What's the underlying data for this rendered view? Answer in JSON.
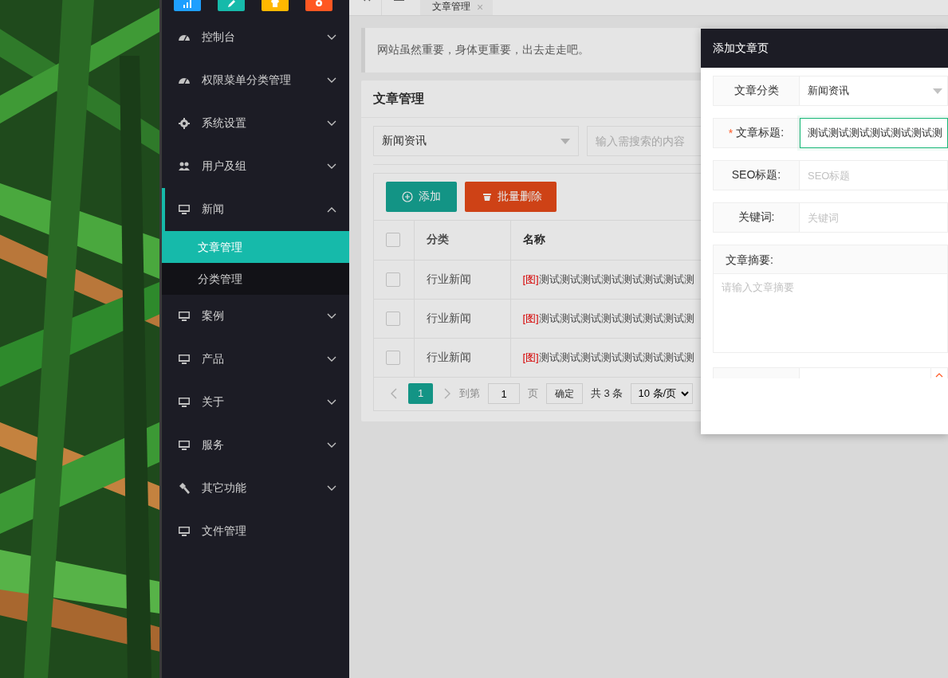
{
  "top_icons": [
    {
      "kind": "chart",
      "color": "#1e9fff"
    },
    {
      "kind": "edit",
      "color": "#16baaa"
    },
    {
      "kind": "shirt",
      "color": "#ffb800"
    },
    {
      "kind": "gear",
      "color": "#ff5722"
    }
  ],
  "sidebar": {
    "items": [
      {
        "label": "控制台",
        "kind": "gauge",
        "expanded": false,
        "selected": false
      },
      {
        "label": "权限菜单分类管理",
        "kind": "gauge",
        "expanded": false,
        "selected": false
      },
      {
        "label": "系统设置",
        "kind": "gear",
        "expanded": false,
        "selected": false
      },
      {
        "label": "用户及组",
        "kind": "users",
        "expanded": false,
        "selected": false
      },
      {
        "label": "新闻",
        "kind": "monitor",
        "expanded": true,
        "selected": true,
        "children": [
          {
            "label": "文章管理",
            "selected": true
          },
          {
            "label": "分类管理",
            "selected": false
          }
        ]
      },
      {
        "label": "案例",
        "kind": "monitor",
        "expanded": false,
        "selected": false
      },
      {
        "label": "产品",
        "kind": "monitor",
        "expanded": false,
        "selected": false
      },
      {
        "label": "关于",
        "kind": "monitor",
        "expanded": false,
        "selected": false
      },
      {
        "label": "服务",
        "kind": "monitor",
        "expanded": false,
        "selected": false
      },
      {
        "label": "其它功能",
        "kind": "hammer",
        "expanded": false,
        "selected": false
      },
      {
        "label": "文件管理",
        "kind": "monitor",
        "selected": false
      }
    ]
  },
  "tabs": [
    {
      "kind": "home",
      "selected": false
    },
    {
      "kind": "page",
      "label": "文章管理",
      "close": "×",
      "selected": true
    }
  ],
  "notice": "网站虽然重要，身体更重要，出去走走吧。",
  "card": {
    "title": "文章管理",
    "filter": {
      "category": "新闻资讯",
      "search_placeholder": "输入需搜索的内容"
    },
    "buttons": [
      {
        "kind": "add",
        "label": "添加"
      },
      {
        "kind": "delete",
        "label": "批量删除"
      }
    ],
    "table": {
      "all_checked": false,
      "columns": [
        "分类",
        "名称"
      ],
      "rows": [
        {
          "checked": false,
          "category": "行业新闻",
          "tag": "[图]",
          "name": "测试测试测试测试测试测试测试测"
        },
        {
          "checked": false,
          "category": "行业新闻",
          "tag": "[图]",
          "name": "测试测试测试测试测试测试测试测"
        },
        {
          "checked": false,
          "category": "行业新闻",
          "tag": "[图]",
          "name": "测试测试测试测试测试测试测试测"
        }
      ]
    },
    "pager": {
      "pages": [
        {
          "label": "1",
          "selected": true
        }
      ],
      "goto_label": "到第",
      "goto_value": "1",
      "page_unit": "页",
      "confirm": "确定",
      "total": "共 3 条",
      "page_size": "10 条/页"
    }
  },
  "modal": {
    "title": "添加文章页",
    "fields": [
      {
        "kind": "select",
        "label": "文章分类",
        "value": "新闻资讯",
        "focused": false
      },
      {
        "kind": "text",
        "label": "文章标题:",
        "required_mark": "*",
        "value": "测试测试测试测试测试测试测",
        "focused": true
      },
      {
        "kind": "text",
        "label": "SEO标题:",
        "placeholder": "SEO标题",
        "focused": false
      },
      {
        "kind": "text",
        "label": "关键词:",
        "placeholder": "关键词",
        "focused": false
      },
      {
        "kind": "textarea",
        "label": "文章摘要:",
        "placeholder": "请输入文章摘要",
        "focused": false
      },
      {
        "kind": "number",
        "focused": false
      }
    ]
  }
}
